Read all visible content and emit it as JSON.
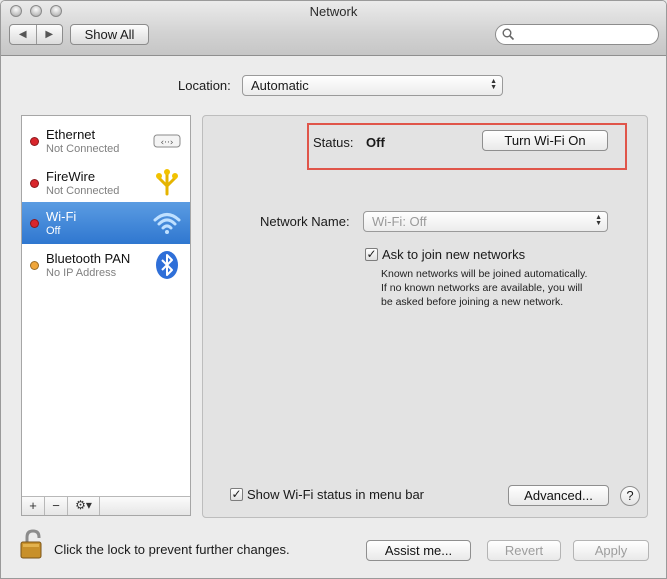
{
  "window": {
    "title": "Network",
    "show_all_label": "Show All",
    "back_glyph": "◀",
    "forward_glyph": "▶"
  },
  "location": {
    "label": "Location:",
    "value": "Automatic"
  },
  "services": [
    {
      "name": "Ethernet",
      "status": "Not Connected",
      "dot_color": "#d9262c",
      "icon": "ethernet-icon"
    },
    {
      "name": "FireWire",
      "status": "Not Connected",
      "dot_color": "#d9262c",
      "icon": "firewire-icon"
    },
    {
      "name": "Wi-Fi",
      "status": "Off",
      "dot_color": "#d9262c",
      "icon": "wifi-icon",
      "selected": true
    },
    {
      "name": "Bluetooth PAN",
      "status": "No IP Address",
      "dot_color": "#f0a63a",
      "icon": "bluetooth-icon"
    }
  ],
  "sidebar_tools": {
    "add": "+",
    "remove": "−",
    "gear": "⚙▾"
  },
  "status": {
    "label": "Status:",
    "value": "Off",
    "toggle_button": "Turn Wi-Fi On"
  },
  "network_name": {
    "label": "Network Name:",
    "value": "Wi-Fi: Off"
  },
  "ask_join": {
    "checked": true,
    "label": "Ask to join new networks",
    "help_lines": [
      "Known networks will be joined automatically.",
      "If no known networks are available, you will",
      "be asked before joining a new network."
    ]
  },
  "menubar_status": {
    "checked": true,
    "label": "Show Wi-Fi status in menu bar"
  },
  "buttons": {
    "advanced": "Advanced...",
    "help": "?",
    "assist": "Assist me...",
    "revert": "Revert",
    "apply": "Apply"
  },
  "lock": {
    "text": "Click the lock to prevent further changes."
  },
  "colors": {
    "selection": "#3a82d8",
    "status_highlight": "#e0554a"
  }
}
